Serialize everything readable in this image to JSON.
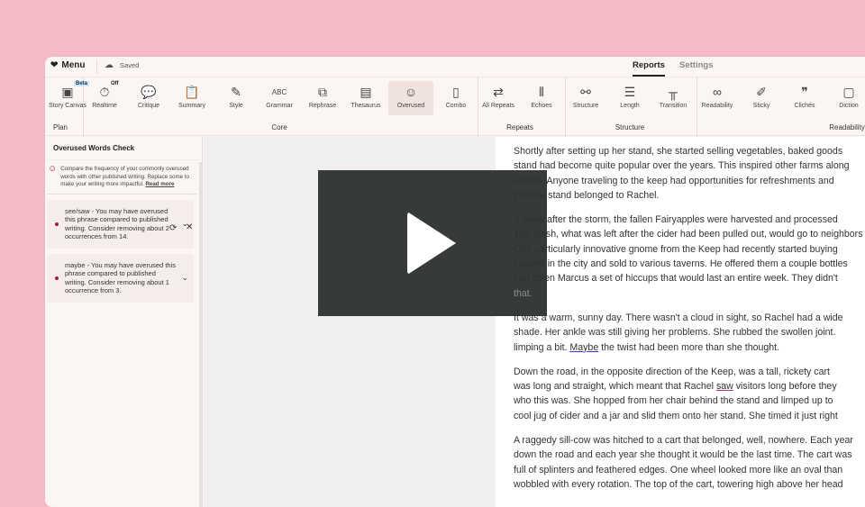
{
  "topbar": {
    "menu_label": "Menu",
    "save_status": "Saved",
    "tabs": [
      {
        "label": "Reports",
        "active": true
      },
      {
        "label": "Settings",
        "active": false
      }
    ]
  },
  "toolbar": {
    "tools": [
      {
        "label": "Story Canvas",
        "icon": "story-canvas-icon",
        "badge": "Beta"
      },
      {
        "label": "Realtime",
        "icon": "timer-icon",
        "badge": "Off"
      },
      {
        "label": "Critique",
        "icon": "critique-icon"
      },
      {
        "label": "Summary",
        "icon": "clipboard-icon"
      },
      {
        "label": "Style",
        "icon": "pen-icon"
      },
      {
        "label": "Grammar",
        "icon": "abc-icon",
        "glyph": "ABC"
      },
      {
        "label": "Rephrase",
        "icon": "rephrase-icon"
      },
      {
        "label": "Thesaurus",
        "icon": "book-icon"
      },
      {
        "label": "Overused",
        "icon": "face-icon"
      },
      {
        "label": "Combo",
        "icon": "combo-icon"
      },
      {
        "label": "All Repeats",
        "icon": "repeat-icon"
      },
      {
        "label": "Echoes",
        "icon": "sound-wave-icon"
      },
      {
        "label": "Structure",
        "icon": "structure-icon"
      },
      {
        "label": "Length",
        "icon": "length-icon"
      },
      {
        "label": "Transition",
        "icon": "bridge-icon"
      },
      {
        "label": "Readability",
        "icon": "glasses-icon"
      },
      {
        "label": "Sticky",
        "icon": "sticky-icon"
      },
      {
        "label": "Clichés",
        "icon": "quote-icon"
      },
      {
        "label": "Diction",
        "icon": "diction-icon"
      }
    ],
    "groups": [
      "Plan",
      "Core",
      "Repeats",
      "Structure",
      "Readability"
    ]
  },
  "panel": {
    "title": "Overused Words Check",
    "intro": "Compare the frequency of your commonly overused words with other published writing. Replace some to make your writing more impactful.",
    "read_more": "Read more",
    "items": [
      {
        "text": "see/saw - You may have overused this phrase compared to published writing. Consider removing about 2 occurrences from 14."
      },
      {
        "text": "maybe - You may have overused this phrase compared to published writing. Consider removing about 1 occurrence from 3."
      }
    ]
  },
  "document": {
    "paragraphs": [
      [
        "Shortly after setting up her stand, she started selling vegetables, baked goods",
        "stand had become quite popular over the years. This inspired other farms along",
        "stands. Anyone traveling to the keep had opportunities for refreshments and",
        "popular stand belonged to Rachel."
      ],
      [
        "A week after the storm, the fallen Fairyapples were harvested and processed",
        "The mash, what was left after the cider had been pulled out, would go to neighbors",
        "One particularly innovative gnome from the Keep had recently started buying",
        "brewed in the city and sold to various taverns. He offered them a couple bottles",
        "had given Marcus a set of hiccups that would last an entire week. They didn't",
        "that."
      ],
      [
        "It was a warm, sunny day. There wasn't a cloud in sight, so Rachel had a wide",
        "shade. Her ankle was still giving her problems. She rubbed the swollen joint.",
        "limping a bit. ",
        "Maybe",
        " the twist had been more than she thought."
      ],
      [
        "Down the road, in the opposite direction of the Keep, was a tall, rickety cart",
        "was long and straight, which meant that Rachel ",
        "saw",
        " visitors long before they",
        "who this was. She hopped from her chair behind the stand and limped up to",
        "cool jug of cider and a jar and slid them onto her stand. She timed it just right"
      ],
      [
        "A raggedy sill-cow was hitched to a cart that belonged, well, nowhere. Each year",
        "down the road and each year she thought it would be the last time. The cart was",
        "full of splinters and feathered edges. One wheel looked more like an oval than",
        "wobbled with every rotation. The top of the cart, towering high above her head"
      ]
    ]
  },
  "video": {
    "state": "paused"
  }
}
